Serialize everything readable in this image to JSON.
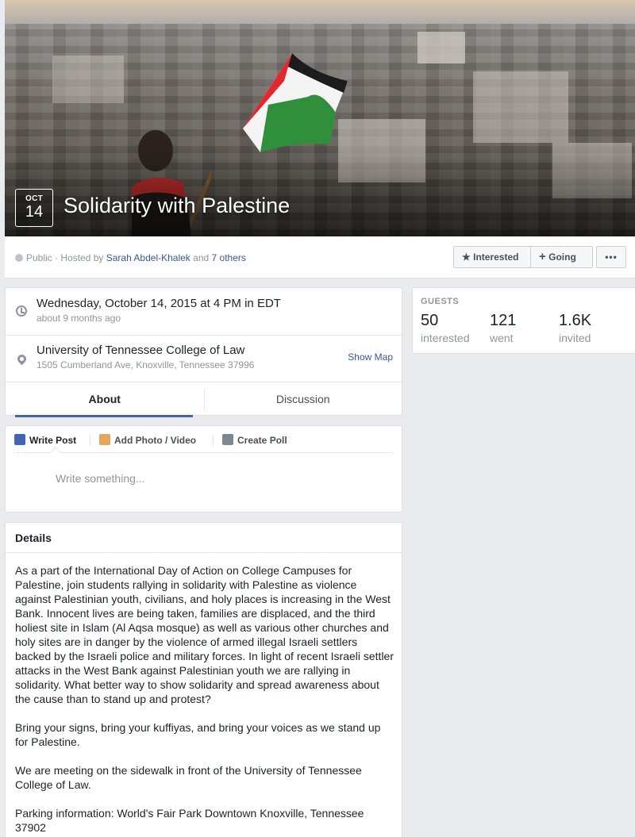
{
  "event": {
    "month": "OCT",
    "day": "14",
    "title": "Solidarity with Palestine"
  },
  "subheader": {
    "privacy": "Public",
    "hosted_by_prefix": "· Hosted by",
    "host": "Sarah Abdel-Khalek",
    "and": "and",
    "others": "7 others",
    "interested_label": "Interested",
    "going_label": "Going",
    "more_label": "•••"
  },
  "info": {
    "datetime": "Wednesday, October 14, 2015 at 4 PM in EDT",
    "relative": "about 9 months ago",
    "venue": "University of Tennessee College of Law",
    "address": "1505 Cumberland Ave, Knoxville, Tennessee 37996",
    "show_map": "Show Map"
  },
  "tabs": {
    "about": "About",
    "discussion": "Discussion"
  },
  "composer": {
    "write_post": "Write Post",
    "add_photo": "Add Photo / Video",
    "create_poll": "Create Poll",
    "placeholder": "Write something..."
  },
  "details": {
    "heading": "Details",
    "paragraphs": [
      "As a part of the International Day of Action on College Campuses for Palestine, join students rallying in solidarity with Palestine as violence against Palestinian youth, civilians, and holy places is increasing in the West Bank. Innocent lives are being taken, families are displaced, and the third holiest site in Islam (Al Aqsa mosque) as well as various other churches and holy sites are in danger by the violence of armed illegal Israeli settlers backed by the Israeli police and military forces. In light of recent Israeli settler attacks in the West Bank against Palestinian youth we are rallying in solidarity. What better way to show solidarity and spread awareness about the cause than to stand up and protest?",
      "Bring your signs, bring your kuffiyas, and bring your voices as we stand up for Palestine.",
      "We are meeting on the sidewalk in front of the University of Tennessee College of Law.",
      "Parking information: World's Fair Park Downtown Knoxville, Tennessee 37902"
    ]
  },
  "guests": {
    "label": "GUESTS",
    "interested_count": "50",
    "interested_label": "interested",
    "went_count": "121",
    "went_label": "went",
    "invited_count": "1.6K",
    "invited_label": "invited"
  },
  "colors": {
    "link": "#365899",
    "accent": "#4267b2",
    "background": "#e9ebee",
    "flag_red": "#e0282f",
    "flag_green": "#2f8f3a"
  }
}
